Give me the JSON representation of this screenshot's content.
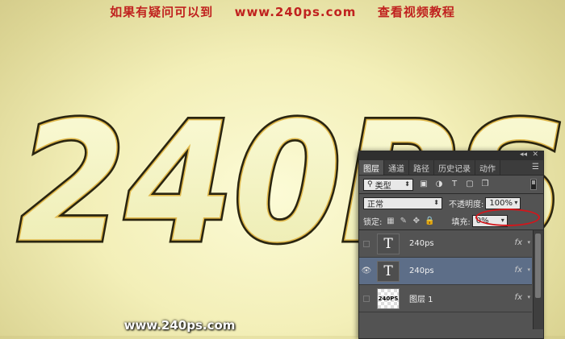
{
  "banner": {
    "left": "如果有疑问可以到",
    "site": "www.240ps.com",
    "right": "查看视频教程"
  },
  "canvas_text": "240PS",
  "footer": "www.240ps.com",
  "colors": {
    "banner": "#c0221f",
    "panel": "#535353",
    "selected_row": "#5d6e88",
    "highlight_ring": "#d3161b"
  },
  "panel": {
    "tabs": [
      "图层",
      "通道",
      "路径",
      "历史记录",
      "动作"
    ],
    "active_tab": "图层",
    "filter": {
      "kind_icon": "search-icon",
      "value": "类型"
    },
    "blend_mode": "正常",
    "opacity_label": "不透明度:",
    "opacity_value": "100%",
    "lock_label": "锁定:",
    "fill_label": "填充:",
    "fill_value": "0%",
    "layers": [
      {
        "name": "240ps",
        "type": "text",
        "visible": false,
        "selected": false,
        "fx": "fx"
      },
      {
        "name": "240ps",
        "type": "text",
        "visible": true,
        "selected": true,
        "fx": "fx"
      },
      {
        "name": "图层 1",
        "type": "image",
        "thumb_text": "240PS",
        "visible": false,
        "selected": false,
        "fx": "fx"
      }
    ]
  }
}
